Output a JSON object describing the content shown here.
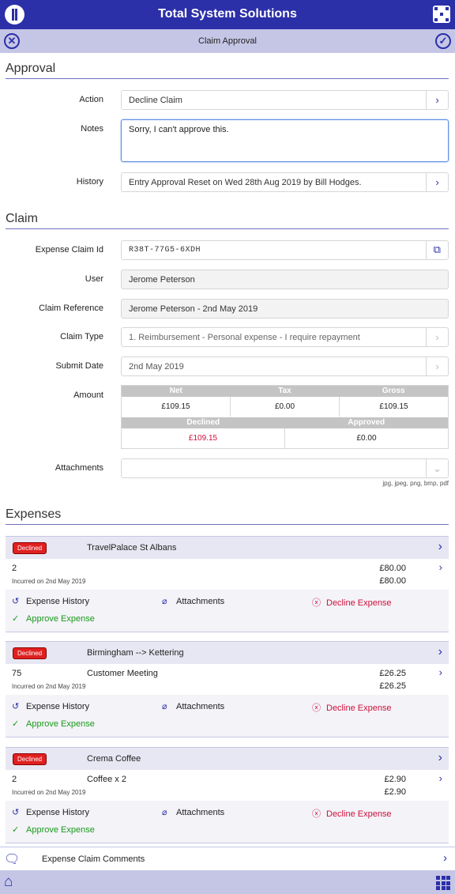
{
  "header": {
    "title": "Total System Solutions"
  },
  "subheader": {
    "title": "Claim Approval"
  },
  "approval": {
    "heading": "Approval",
    "action_label": "Action",
    "action_value": "Decline Claim",
    "notes_label": "Notes",
    "notes_value": "Sorry, I can't approve this.",
    "history_label": "History",
    "history_value": "Entry Approval Reset on Wed 28th Aug 2019 by Bill Hodges."
  },
  "claim": {
    "heading": "Claim",
    "id_label": "Expense Claim Id",
    "id_value": "R38T-77G5-6XDH",
    "user_label": "User",
    "user_value": "Jerome Peterson",
    "ref_label": "Claim Reference",
    "ref_value": "Jerome Peterson - 2nd May 2019",
    "type_label": "Claim Type",
    "type_value": "1. Reimbursement  - Personal expense - I require repayment",
    "date_label": "Submit Date",
    "date_value": "2nd May 2019",
    "amount_label": "Amount",
    "amount": {
      "net_h": "Net",
      "tax_h": "Tax",
      "gross_h": "Gross",
      "net": "£109.15",
      "tax": "£0.00",
      "gross": "£109.15",
      "declined_h": "Declined",
      "approved_h": "Approved",
      "declined": "£109.15",
      "approved": "£0.00"
    },
    "attach_label": "Attachments",
    "attach_hint": "jpg, jpeg, png, bmp, pdf"
  },
  "expenses": {
    "heading": "Expenses",
    "action_history": "Expense History",
    "action_attachments": "Attachments",
    "action_decline": "Decline Expense",
    "action_approve": "Approve Expense",
    "items": [
      {
        "status": "Declined",
        "title": "TravelPalace St Albans",
        "qty": "2",
        "desc": "",
        "incurred": "Incurred on 2nd May 2019",
        "amount1": "£80.00",
        "amount2": "£80.00"
      },
      {
        "status": "Declined",
        "title": "Birmingham --> Kettering",
        "qty": "75",
        "desc": "Customer Meeting",
        "incurred": "Incurred on 2nd May 2019",
        "amount1": "£26.25",
        "amount2": "£26.25"
      },
      {
        "status": "Declined",
        "title": "Crema Coffee",
        "qty": "2",
        "desc": "Coffee x 2",
        "incurred": "Incurred on 2nd May 2019",
        "amount1": "£2.90",
        "amount2": "£2.90"
      }
    ]
  },
  "comments": {
    "label": "Expense Claim Comments"
  },
  "colors": {
    "brand": "#2b2fa8",
    "subbar": "#c5c6e6",
    "declined": "#e02020",
    "approve": "#1a9a1a",
    "decline_text": "#d0103a"
  }
}
